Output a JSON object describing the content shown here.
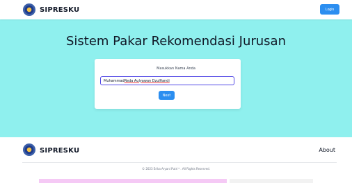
{
  "header": {
    "brand": "SIPRESKU",
    "login_label": "Login"
  },
  "hero": {
    "title": "Sistem Pakar Rekomendasi Jurusan",
    "form_label": "Masukkan Nama Anda",
    "name_value_part1": "Muhammad ",
    "name_value_part2": "Reda Aulyawan Dzulfiandi",
    "next_label": "Next"
  },
  "footer": {
    "brand": "SIPRESKU",
    "about_label": "About",
    "copyright": "© 2023 Erika Aryani Putri™. All Rights Reserved."
  },
  "colors": {
    "hero_bg": "#8ff0ee",
    "button": "#2b8ef0",
    "input_border": "#4f46e5"
  }
}
